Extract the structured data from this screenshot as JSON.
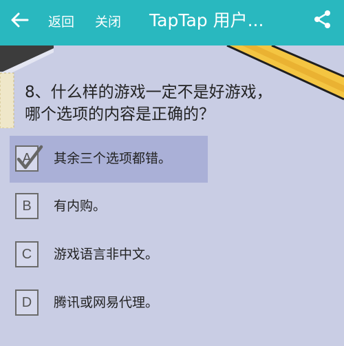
{
  "header": {
    "back_label": "返回",
    "close_label": "关闭",
    "title": "TapTap 用户...",
    "icons": {
      "back": "arrow-left-icon",
      "share": "share-icon"
    }
  },
  "question": {
    "text_line1": "8、什么样的游戏一定不是好游戏，",
    "text_line2": "哪个选项的内容是正确的？"
  },
  "options": [
    {
      "letter": "A",
      "text": "其余三个选项都错。",
      "selected": true
    },
    {
      "letter": "B",
      "text": "有内购。",
      "selected": false
    },
    {
      "letter": "C",
      "text": "游戏语言非中文。",
      "selected": false
    },
    {
      "letter": "D",
      "text": "腾讯或网易代理。",
      "selected": false
    }
  ],
  "colors": {
    "header": "#29b8bf",
    "background": "#c9cde4",
    "selected_row": "#aab0d7",
    "decor_yellow": "#f4c542"
  }
}
